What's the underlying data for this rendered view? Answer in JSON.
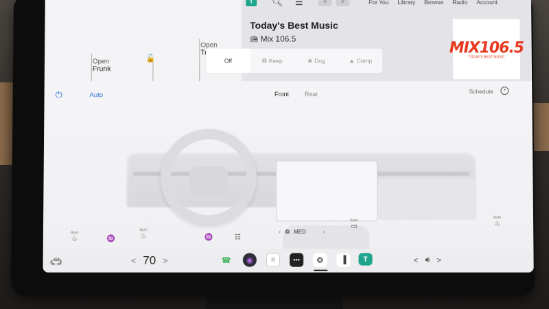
{
  "music": {
    "tidal_label": "T",
    "nav_links": [
      "For You",
      "Library",
      "Browse",
      "Radio",
      "Account"
    ],
    "title": "Today's Best Music",
    "station": "Mix 106.5",
    "album_text": "MIX106.5",
    "album_sub": "TODAY'S BEST MUSIC",
    "back_arrow": "<",
    "fwd_arrow": ">"
  },
  "vehicle": {
    "frunk_open": "Open",
    "frunk_label": "Frunk",
    "trunk_open": "Open",
    "trunk_label": "Tr"
  },
  "modes": {
    "items": [
      "Off",
      "Keep",
      "Dog",
      "Camp"
    ],
    "active": "Off"
  },
  "climate": {
    "auto_label": "Auto",
    "front_label": "Front",
    "rear_label": "Rear",
    "schedule_label": "Schedule",
    "fan_label": "MED",
    "auto_small": "Auto",
    "colors": {
      "accent": "#2f6fd6"
    }
  },
  "dock": {
    "temperature": "70",
    "left_chev": "<",
    "right_chev": ">",
    "volume_prev": "<",
    "volume_next": ">"
  }
}
